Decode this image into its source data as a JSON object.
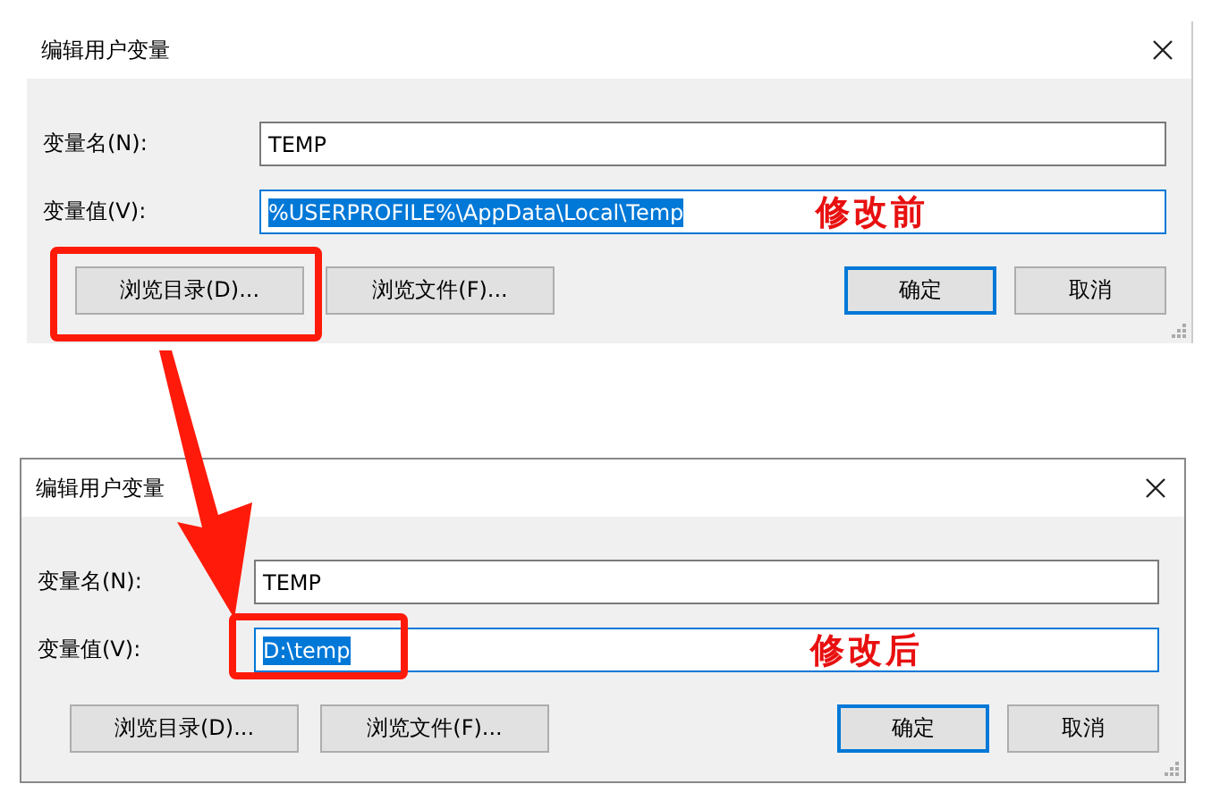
{
  "dialogs": [
    {
      "title": "编辑用户变量",
      "note": "修改前",
      "fields": [
        {
          "label": "变量名(N):",
          "value": "TEMP",
          "focused": false,
          "highlighted": false
        },
        {
          "label": "变量值(V):",
          "value": "%USERPROFILE%\\AppData\\Local\\Temp",
          "focused": true,
          "highlighted": false
        }
      ],
      "buttons": [
        {
          "label": "浏览目录(D)...",
          "default": false,
          "highlighted": true
        },
        {
          "label": "浏览文件(F)...",
          "default": false,
          "highlighted": false
        },
        {
          "label": "确定",
          "default": true,
          "highlighted": false
        },
        {
          "label": "取消",
          "default": false,
          "highlighted": false
        }
      ]
    },
    {
      "title": "编辑用户变量",
      "note": "修改后",
      "fields": [
        {
          "label": "变量名(N):",
          "value": "TEMP",
          "focused": false,
          "highlighted": false
        },
        {
          "label": "变量值(V):",
          "value": "D:\\temp",
          "focused": true,
          "highlighted": true
        }
      ],
      "buttons": [
        {
          "label": "浏览目录(D)...",
          "default": false,
          "highlighted": false
        },
        {
          "label": "浏览文件(F)...",
          "default": false,
          "highlighted": false
        },
        {
          "label": "确定",
          "default": true,
          "highlighted": false
        },
        {
          "label": "取消",
          "default": false,
          "highlighted": false
        }
      ]
    }
  ]
}
